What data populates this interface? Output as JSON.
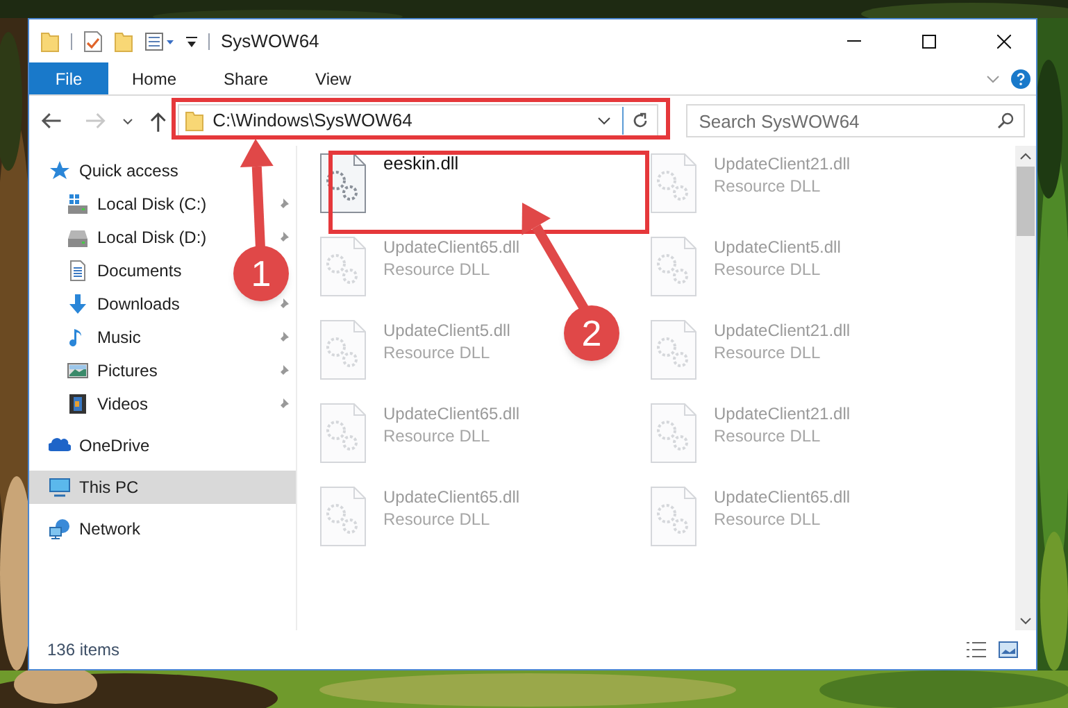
{
  "window": {
    "title": "SysWOW64"
  },
  "ribbon_tabs": [
    {
      "label": "File",
      "kind": "file"
    },
    {
      "label": "Home",
      "kind": "tab"
    },
    {
      "label": "Share",
      "kind": "tab"
    },
    {
      "label": "View",
      "kind": "tab"
    }
  ],
  "navigation": {
    "back_disabled": false,
    "forward_disabled": true
  },
  "address": {
    "path": "C:\\Windows\\SysWOW64",
    "highlighted": true
  },
  "search": {
    "placeholder": "Search SysWOW64"
  },
  "sidebar": {
    "items": [
      {
        "label": "Quick access",
        "kind": "quick",
        "selected": false,
        "children": [
          {
            "label": "Local Disk (C:)",
            "kind": "disk_c",
            "pinned": true
          },
          {
            "label": "Local Disk (D:)",
            "kind": "disk",
            "pinned": true
          },
          {
            "label": "Documents",
            "kind": "documents",
            "pinned": false
          },
          {
            "label": "Downloads",
            "kind": "downloads",
            "pinned": true
          },
          {
            "label": "Music",
            "kind": "music",
            "pinned": true
          },
          {
            "label": "Pictures",
            "kind": "pictures",
            "pinned": true
          },
          {
            "label": "Videos",
            "kind": "videos",
            "pinned": true
          }
        ]
      },
      {
        "label": "OneDrive",
        "kind": "onedrive",
        "selected": false
      },
      {
        "label": "This PC",
        "kind": "pc",
        "selected": true
      },
      {
        "label": "Network",
        "kind": "network",
        "selected": false
      }
    ]
  },
  "files": [
    {
      "name": "eeskin.dll",
      "faded": false,
      "highlighted": true
    },
    {
      "name": "UpdateClient21.dll",
      "type": "Resource DLL",
      "faded": true,
      "highlighted": false
    },
    {
      "name": "UpdateClient65.dll",
      "type": "Resource DLL",
      "faded": true,
      "highlighted": false
    },
    {
      "name": "UpdateClient5.dll",
      "type": "Resource DLL",
      "faded": true,
      "highlighted": false
    },
    {
      "name": "UpdateClient5.dll",
      "type": "Resource DLL",
      "faded": true,
      "highlighted": false
    },
    {
      "name": "UpdateClient21.dll",
      "type": "Resource DLL",
      "faded": true,
      "highlighted": false
    },
    {
      "name": "UpdateClient65.dll",
      "type": "Resource DLL",
      "faded": true,
      "highlighted": false
    },
    {
      "name": "UpdateClient21.dll",
      "type": "Resource DLL",
      "faded": true,
      "highlighted": false
    },
    {
      "name": "UpdateClient65.dll",
      "type": "Resource DLL",
      "faded": true,
      "highlighted": false
    },
    {
      "name": "UpdateClient65.dll",
      "type": "Resource DLL",
      "faded": true,
      "highlighted": false
    }
  ],
  "status_bar": {
    "item_count": "136 items"
  },
  "callouts": [
    {
      "number": "1"
    },
    {
      "number": "2"
    }
  ]
}
